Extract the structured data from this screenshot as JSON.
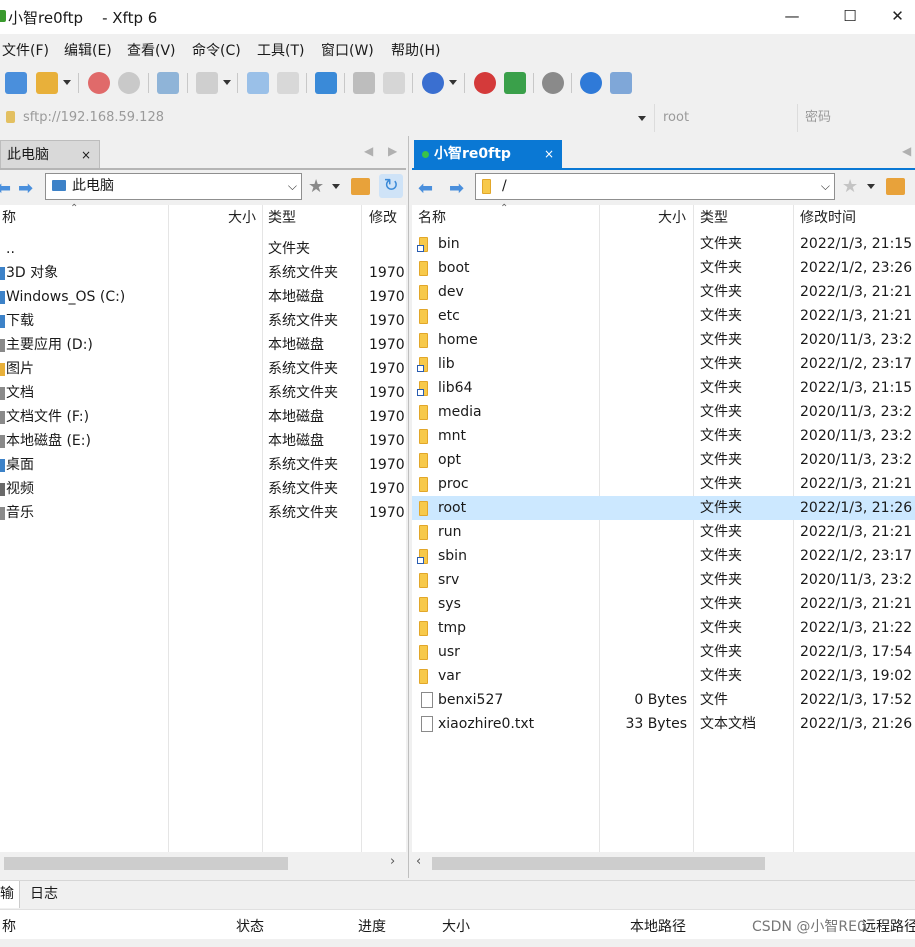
{
  "window": {
    "title": "小智re0ftp    - Xftp 6",
    "minimize": "—",
    "maximize": "☐",
    "close": "✕"
  },
  "menu": [
    "文件(F)",
    "编辑(E)",
    "查看(V)",
    "命令(C)",
    "工具(T)",
    "窗口(W)",
    "帮助(H)"
  ],
  "address": {
    "url": "sftp://192.168.59.128",
    "user": "root",
    "password_placeholder": "密码"
  },
  "left": {
    "tab_label": "此电脑",
    "tab_close": "×",
    "path": "此电脑",
    "columns": [
      "称",
      "大小",
      "类型",
      "修改的"
    ],
    "rows": [
      {
        "name": "..",
        "size": "",
        "type": "文件夹",
        "modified": ""
      },
      {
        "name": "3D 对象",
        "size": "",
        "type": "系统文件夹",
        "modified": "1970"
      },
      {
        "name": "Windows_OS (C:)",
        "size": "",
        "type": "本地磁盘",
        "modified": "1970"
      },
      {
        "name": "下载",
        "size": "",
        "type": "系统文件夹",
        "modified": "1970"
      },
      {
        "name": "主要应用 (D:)",
        "size": "",
        "type": "本地磁盘",
        "modified": "1970"
      },
      {
        "name": "图片",
        "size": "",
        "type": "系统文件夹",
        "modified": "1970"
      },
      {
        "name": "文档",
        "size": "",
        "type": "系统文件夹",
        "modified": "1970"
      },
      {
        "name": "文档文件 (F:)",
        "size": "",
        "type": "本地磁盘",
        "modified": "1970"
      },
      {
        "name": "本地磁盘 (E:)",
        "size": "",
        "type": "本地磁盘",
        "modified": "1970"
      },
      {
        "name": "桌面",
        "size": "",
        "type": "系统文件夹",
        "modified": "1970"
      },
      {
        "name": "视频",
        "size": "",
        "type": "系统文件夹",
        "modified": "1970"
      },
      {
        "name": "音乐",
        "size": "",
        "type": "系统文件夹",
        "modified": "1970"
      }
    ]
  },
  "right": {
    "tab_label": "小智re0ftp",
    "tab_close": "×",
    "path": "/",
    "columns": [
      "名称",
      "大小",
      "类型",
      "修改时间"
    ],
    "selected_row": "root",
    "rows": [
      {
        "name": "bin",
        "size": "",
        "type": "文件夹",
        "modified": "2022/1/3, 21:15",
        "icon": "folder-link"
      },
      {
        "name": "boot",
        "size": "",
        "type": "文件夹",
        "modified": "2022/1/2, 23:26",
        "icon": "folder"
      },
      {
        "name": "dev",
        "size": "",
        "type": "文件夹",
        "modified": "2022/1/3, 21:21",
        "icon": "folder"
      },
      {
        "name": "etc",
        "size": "",
        "type": "文件夹",
        "modified": "2022/1/3, 21:21",
        "icon": "folder"
      },
      {
        "name": "home",
        "size": "",
        "type": "文件夹",
        "modified": "2020/11/3, 23:2",
        "icon": "folder"
      },
      {
        "name": "lib",
        "size": "",
        "type": "文件夹",
        "modified": "2022/1/2, 23:17",
        "icon": "folder-link"
      },
      {
        "name": "lib64",
        "size": "",
        "type": "文件夹",
        "modified": "2022/1/3, 21:15",
        "icon": "folder-link"
      },
      {
        "name": "media",
        "size": "",
        "type": "文件夹",
        "modified": "2020/11/3, 23:2",
        "icon": "folder"
      },
      {
        "name": "mnt",
        "size": "",
        "type": "文件夹",
        "modified": "2020/11/3, 23:2",
        "icon": "folder"
      },
      {
        "name": "opt",
        "size": "",
        "type": "文件夹",
        "modified": "2020/11/3, 23:2",
        "icon": "folder"
      },
      {
        "name": "proc",
        "size": "",
        "type": "文件夹",
        "modified": "2022/1/3, 21:21",
        "icon": "folder"
      },
      {
        "name": "root",
        "size": "",
        "type": "文件夹",
        "modified": "2022/1/3, 21:26",
        "icon": "folder"
      },
      {
        "name": "run",
        "size": "",
        "type": "文件夹",
        "modified": "2022/1/3, 21:21",
        "icon": "folder"
      },
      {
        "name": "sbin",
        "size": "",
        "type": "文件夹",
        "modified": "2022/1/2, 23:17",
        "icon": "folder-link"
      },
      {
        "name": "srv",
        "size": "",
        "type": "文件夹",
        "modified": "2020/11/3, 23:2",
        "icon": "folder"
      },
      {
        "name": "sys",
        "size": "",
        "type": "文件夹",
        "modified": "2022/1/3, 21:21",
        "icon": "folder"
      },
      {
        "name": "tmp",
        "size": "",
        "type": "文件夹",
        "modified": "2022/1/3, 21:22",
        "icon": "folder"
      },
      {
        "name": "usr",
        "size": "",
        "type": "文件夹",
        "modified": "2022/1/3, 17:54",
        "icon": "folder"
      },
      {
        "name": "var",
        "size": "",
        "type": "文件夹",
        "modified": "2022/1/3, 19:02",
        "icon": "folder"
      },
      {
        "name": "benxi527",
        "size": "0 Bytes",
        "type": "文件",
        "modified": "2022/1/3, 17:52",
        "icon": "file"
      },
      {
        "name": "xiaozhire0.txt",
        "size": "33 Bytes",
        "type": "文本文档",
        "modified": "2022/1/3, 21:26",
        "icon": "text-file"
      }
    ]
  },
  "bottom": {
    "tabs": [
      "输",
      "日志"
    ],
    "columns": [
      "称",
      "状态",
      "进度",
      "大小",
      "本地路径",
      "远程路径"
    ],
    "watermark": "CSDN @小智RE0"
  },
  "colors": {
    "accent": "#0078d7",
    "selected_row": "#cce8ff",
    "tab_active": "#0a78d4",
    "folder": "#f7c94a"
  }
}
